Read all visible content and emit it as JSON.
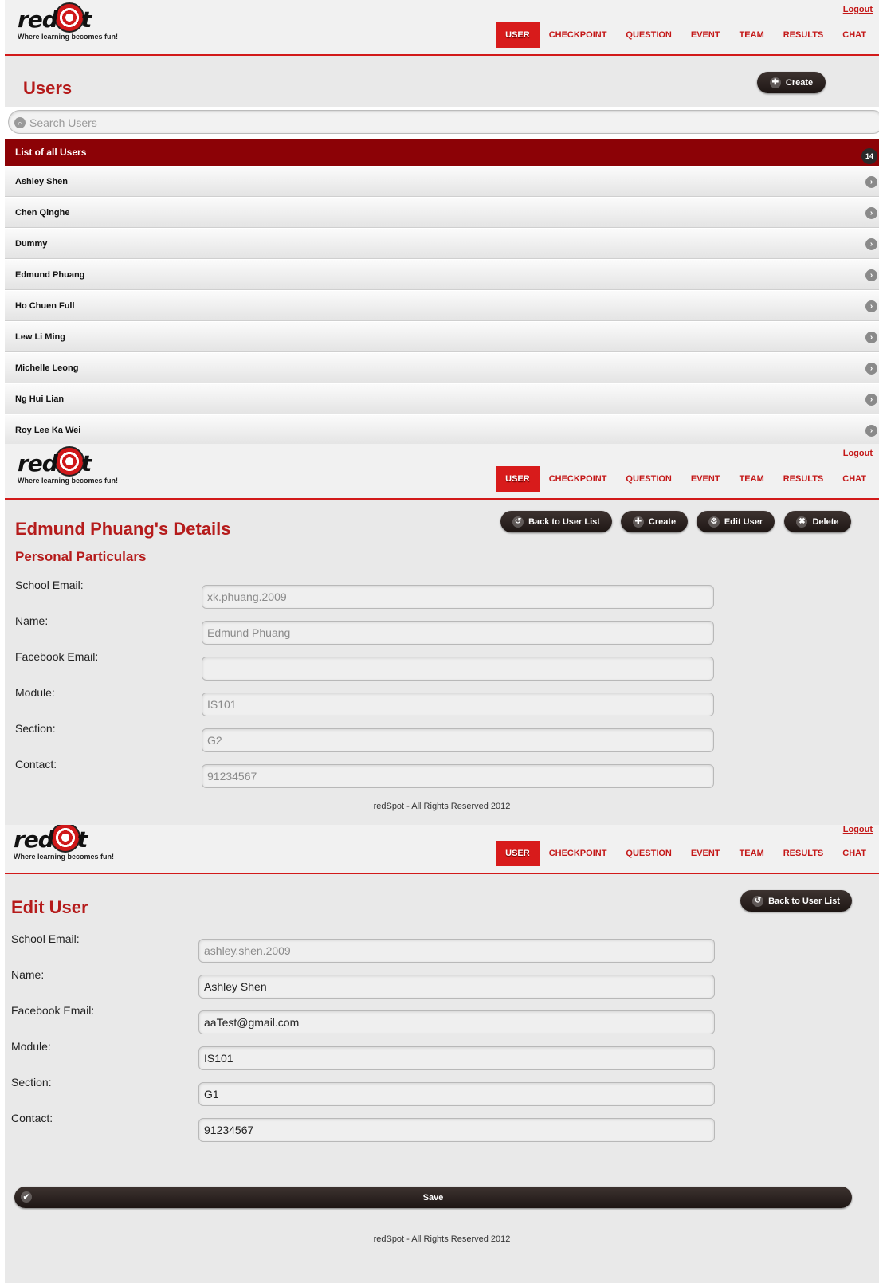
{
  "header": {
    "logo_prefix": "red",
    "logo_suffix": "t",
    "tagline": "Where learning becomes fun!",
    "logout": "Logout",
    "nav": [
      "USER",
      "CHECKPOINT",
      "QUESTION",
      "EVENT",
      "TEAM",
      "RESULTS",
      "CHAT"
    ]
  },
  "list_page": {
    "title": "Users",
    "create_label": "Create",
    "search_placeholder": "Search Users",
    "list_header": "List of all Users",
    "count": "14",
    "users": [
      "Ashley Shen",
      "Chen Qinghe",
      "Dummy",
      "Edmund Phuang",
      "Ho Chuen Full",
      "Lew Li Ming",
      "Michelle Leong",
      "Ng Hui Lian",
      "Roy Lee Ka Wei"
    ]
  },
  "details_page": {
    "title": "Edmund Phuang's Details",
    "subtitle": "Personal Particulars",
    "buttons": {
      "back": "Back to User List",
      "create": "Create",
      "edit": "Edit User",
      "delete": "Delete"
    },
    "fields": [
      {
        "label": "School Email:",
        "value": "xk.phuang.2009"
      },
      {
        "label": "Name:",
        "value": "Edmund Phuang"
      },
      {
        "label": "Facebook Email:",
        "value": ""
      },
      {
        "label": "Module:",
        "value": "IS101"
      },
      {
        "label": "Section:",
        "value": "G2"
      },
      {
        "label": "Contact:",
        "value": "91234567"
      }
    ],
    "footer": "redSpot - All Rights Reserved 2012"
  },
  "edit_page": {
    "title": "Edit User",
    "back_label": "Back to User List",
    "fields": [
      {
        "label": "School Email:",
        "value": "ashley.shen.2009"
      },
      {
        "label": "Name:",
        "value": "Ashley Shen"
      },
      {
        "label": "Facebook Email:",
        "value": "aaTest@gmail.com"
      },
      {
        "label": "Module:",
        "value": "IS101"
      },
      {
        "label": "Section:",
        "value": "G1"
      },
      {
        "label": "Contact:",
        "value": "91234567"
      }
    ],
    "save_label": "Save",
    "footer": "redSpot - All Rights Reserved 2012"
  },
  "icons": {
    "create": "plus-icon",
    "back": "back-arrow-icon",
    "edit": "gear-icon",
    "delete": "x-icon",
    "save": "check-icon",
    "row": "chevron-right-icon",
    "search": "search-icon"
  },
  "colors": {
    "brand_red": "#d81b1b",
    "list_header": "#8c0206",
    "title_red": "#b51b1b",
    "button_dark": "#2a201d"
  }
}
